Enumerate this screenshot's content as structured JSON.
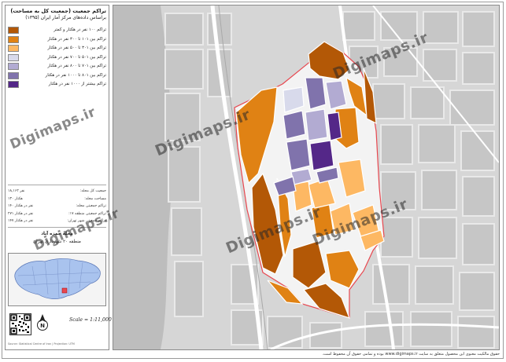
{
  "title": {
    "line1": "تراکم جمعیت (جمعیت کل به مساحت)",
    "line2": "براساس داده‌های مرکز آمار ایران (۱۳۹۵)"
  },
  "legend": [
    {
      "label": "تراکم ۱۰۰ نفر در هکتار و کمتر",
      "color": "#b35806"
    },
    {
      "label": "تراکم بین ۱۰۱ تا ۳۰۰ نفر در هکتار",
      "color": "#e08214"
    },
    {
      "label": "تراکم بین ۳۰۱ تا ۵۰۰ نفر در هکتار",
      "color": "#fdb863"
    },
    {
      "label": "تراکم بین ۵۰۱ تا ۷۰۰ نفر در هکتار",
      "color": "#d8daeb"
    },
    {
      "label": "تراکم بین ۷۰۱ تا ۸۰۰ نفر در هکتار",
      "color": "#b2abd2"
    },
    {
      "label": "تراکم بین ۸۰۱ تا ۱۰۰۰ نفر در هکتار",
      "color": "#8073ac"
    },
    {
      "label": "تراکم بیشتر از ۱۰۰۰ نفر در هکتار",
      "color": "#542788"
    }
  ],
  "stats": [
    {
      "label": "جمعیت کل محله:",
      "value": "۱۸,۱۶۲ نفر"
    },
    {
      "label": "مساحت محله:",
      "value": "۱۳۰ هکتار"
    },
    {
      "label": "تراکم جمعیتی محله:",
      "value": "۱۴۰ نفر در هکتار"
    },
    {
      "label": "تراکم جمعیتی منطقه ۱۷:",
      "value": "۲۷۱ نفر در هکتار"
    },
    {
      "label": "تراکم جمعیتی شهر تهران:",
      "value": "۱۴۷ نفر در هکتار"
    }
  ],
  "area": {
    "line1": "محله حمزه آباد",
    "line2": "منطقه ۲۰ شهرداری تهران"
  },
  "scale": "Scale = 1:11,000",
  "north_label": "N",
  "side_footer": "Source: Statistical Centre of Iran | Projection: UTM",
  "footer": "حقوق مالکیت معنوی این محصول متعلق به سایت www.digimaps.ir بوده و تمامی حقوق آن محفوظ است.",
  "watermark": "Digimaps.ir",
  "colors": {
    "c1": "#b35806",
    "c2": "#e08214",
    "c3": "#fdb863",
    "c4": "#d8daeb",
    "c5": "#b2abd2",
    "c6": "#8073ac",
    "c7": "#542788",
    "boundary": "#e8474f",
    "road": "#ffffff",
    "block": "#c8c8c8"
  }
}
